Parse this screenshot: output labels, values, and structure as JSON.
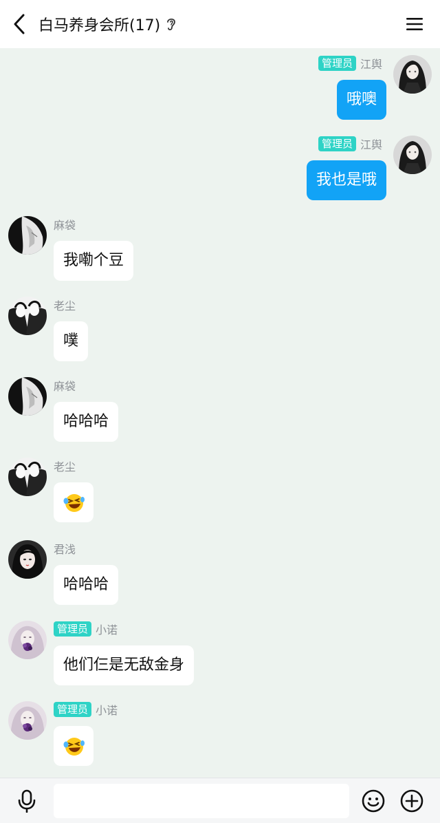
{
  "header": {
    "title": "白马养身会所(17)",
    "back_icon": "chevron-left-icon",
    "ear_icon": "ear-icon",
    "menu_icon": "menu-icon"
  },
  "colors": {
    "chat_background": "#edf3ef",
    "self_bubble": "#12a3f6",
    "other_bubble": "#ffffff",
    "admin_badge": "#2ed3c6",
    "sender_name": "#8d9196"
  },
  "messages": [
    {
      "side": "right",
      "badge": "管理员",
      "sender": "江舆",
      "text": "哦噢"
    },
    {
      "side": "right",
      "badge": "管理员",
      "sender": "江舆",
      "text": "我也是哦"
    },
    {
      "side": "left",
      "badge": "",
      "sender": "麻袋",
      "text": "我嘞个豆"
    },
    {
      "side": "left",
      "badge": "",
      "sender": "老尘",
      "text": "噗"
    },
    {
      "side": "left",
      "badge": "",
      "sender": "麻袋",
      "text": "哈哈哈"
    },
    {
      "side": "left",
      "badge": "",
      "sender": "老尘",
      "text": "",
      "emoji": "laughing-tears-emoji"
    },
    {
      "side": "left",
      "badge": "",
      "sender": "君浅",
      "text": "哈哈哈"
    },
    {
      "side": "left",
      "badge": "管理员",
      "sender": "小诺",
      "text": "他们仨是无敌金身"
    },
    {
      "side": "left",
      "badge": "管理员",
      "sender": "小诺",
      "text": "",
      "emoji": "laughing-tears-emoji"
    }
  ],
  "input_bar": {
    "placeholder": "",
    "mic_icon": "microphone-icon",
    "emoji_icon": "smiley-icon",
    "plus_icon": "plus-circle-icon"
  }
}
